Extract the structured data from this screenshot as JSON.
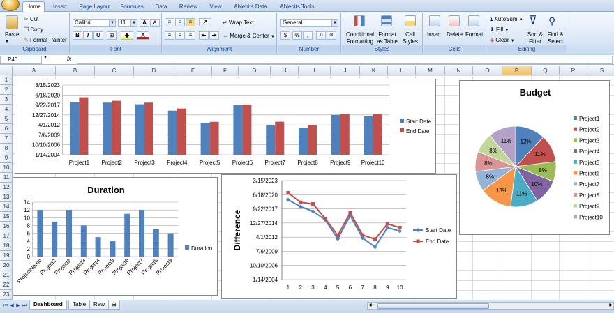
{
  "tabs": [
    "Home",
    "Insert",
    "Page Layout",
    "Formulas",
    "Data",
    "Review",
    "View",
    "Ablebits Data",
    "Ablebits Tools"
  ],
  "clipboard": {
    "paste": "Paste",
    "cut": "Cut",
    "copy": "Copy",
    "format_painter": "Format Painter",
    "label": "Clipboard"
  },
  "font": {
    "name": "Calibri",
    "size": "11",
    "label": "Font",
    "bold": "B",
    "italic": "I",
    "underline": "U",
    "grow": "A",
    "shrink": "A"
  },
  "alignment": {
    "wrap": "Wrap Text",
    "merge": "Merge & Center",
    "label": "Alignment"
  },
  "number": {
    "format": "General",
    "currency": "$",
    "percent": "%",
    "comma": ",",
    "inc": ".0",
    "dec": ".00",
    "label": "Number"
  },
  "styles": {
    "cond1": "Conditional",
    "cond2": "Formatting",
    "table1": "Format",
    "table2": "as Table",
    "cell1": "Cell",
    "cell2": "Styles",
    "label": "Styles"
  },
  "cells": {
    "insert": "Insert",
    "delete": "Delete",
    "format": "Format",
    "label": "Cells"
  },
  "editing": {
    "autosum": "AutoSum",
    "fill": "Fill",
    "clear": "Clear",
    "sort1": "Sort &",
    "sort2": "Filter",
    "find1": "Find &",
    "find2": "Select",
    "label": "Editing"
  },
  "formula_bar": {
    "name_box": "P40",
    "fx": "fx",
    "value": ""
  },
  "columns": [
    "A",
    "B",
    "C",
    "D",
    "E",
    "F",
    "G",
    "H",
    "I",
    "J",
    "K",
    "L",
    "M",
    "N",
    "O",
    "P",
    "Q",
    "R",
    "S"
  ],
  "selected_column": "P",
  "rows": [
    "1",
    "2",
    "3",
    "4",
    "5",
    "6",
    "7",
    "8",
    "9",
    "10",
    "11",
    "12",
    "13",
    "14",
    "15",
    "16",
    "17",
    "18",
    "19",
    "20",
    "21",
    "22",
    "23"
  ],
  "sheets": [
    "Dashboard",
    "Table",
    "Raw"
  ],
  "active_sheet": "Dashboard",
  "colors": {
    "blue": "#4f81bd",
    "red": "#c0504d",
    "ribbon": "#dbe7f6"
  },
  "chart_data": [
    {
      "type": "bar",
      "title": "",
      "categories": [
        "Project1",
        "Project2",
        "Project3",
        "Project4",
        "Project5",
        "Project6",
        "Project7",
        "Project8",
        "Project9",
        "Project10"
      ],
      "y_ticks": [
        "1/14/2004",
        "10/10/2006",
        "7/6/2009",
        "4/1/2012",
        "12/27/2014",
        "9/22/2017",
        "6/18/2020",
        "3/15/2023"
      ],
      "ylim": [
        "1/14/2004",
        "3/15/2023"
      ],
      "legend_position": "right",
      "series": [
        {
          "name": "Start Date",
          "values": [
            "7/1/2018",
            "5/15/2018",
            "12/1/2017",
            "3/1/2016",
            "11/1/2012",
            "9/15/2017",
            "4/15/2012",
            "6/1/2011",
            "1/1/2015",
            "8/15/2014"
          ]
        },
        {
          "name": "End Date",
          "values": [
            "11/1/2019",
            "11/15/2018",
            "5/15/2018",
            "10/1/2016",
            "2/1/2013",
            "11/1/2017",
            "2/15/2013",
            "3/1/2012",
            "5/1/2015",
            "3/15/2015"
          ]
        }
      ]
    },
    {
      "type": "pie",
      "title": "Budget",
      "categories": [
        "Project1",
        "Project2",
        "Project3",
        "Project4",
        "Project5",
        "Project6",
        "Project7",
        "Project8",
        "Project9",
        "Project10"
      ],
      "values": [
        12,
        11,
        8,
        10,
        11,
        13,
        8,
        8,
        8,
        11
      ],
      "labels": [
        "12%",
        "11%",
        "8%",
        "10%",
        "11%",
        "13%",
        "8%",
        "8%",
        "8%",
        "11%"
      ],
      "colors": [
        "#4f81bd",
        "#c0504d",
        "#9bbb59",
        "#8064a2",
        "#4bacc6",
        "#f79646",
        "#95b3d7",
        "#d99694",
        "#c3d69b",
        "#b3a2c7"
      ],
      "legend_position": "right"
    },
    {
      "type": "bar",
      "title": "Duration",
      "categories": [
        "ProjectName",
        "Project1",
        "Project2",
        "Project3",
        "Project4",
        "Project5",
        "Project6",
        "Project7",
        "Project8",
        "Project9"
      ],
      "y_ticks": [
        "0",
        "2",
        "4",
        "6",
        "8",
        "10",
        "12",
        "14"
      ],
      "ylim": [
        0,
        14
      ],
      "legend_position": "right",
      "series": [
        {
          "name": "Duration",
          "values": [
            12,
            9,
            12,
            8,
            5,
            4,
            11,
            12,
            7,
            6
          ]
        }
      ]
    },
    {
      "type": "line",
      "title": "",
      "ylabel": "Difference",
      "x": [
        "1",
        "2",
        "3",
        "4",
        "5",
        "6",
        "7",
        "8",
        "9",
        "10"
      ],
      "y_ticks": [
        "1/14/2004",
        "10/10/2006",
        "7/6/2009",
        "4/1/2012",
        "12/27/2014",
        "9/22/2017",
        "6/18/2020",
        "3/15/2023"
      ],
      "ylim": [
        "1/14/2004",
        "3/15/2023"
      ],
      "legend_position": "right",
      "series": [
        {
          "name": "Start Date",
          "values": [
            "7/1/2019",
            "3/1/2018",
            "4/1/2017",
            "8/1/2015",
            "12/1/2011",
            "6/1/2016",
            "2/1/2012",
            "5/1/2010",
            "2/1/2014",
            "6/1/2013"
          ]
        },
        {
          "name": "End Date",
          "values": [
            "11/1/2020",
            "1/1/2019",
            "9/1/2018",
            "11/1/2015",
            "8/1/2012",
            "1/1/2017",
            "9/1/2012",
            "11/1/2011",
            "11/1/2014",
            "2/1/2014"
          ]
        }
      ]
    }
  ]
}
